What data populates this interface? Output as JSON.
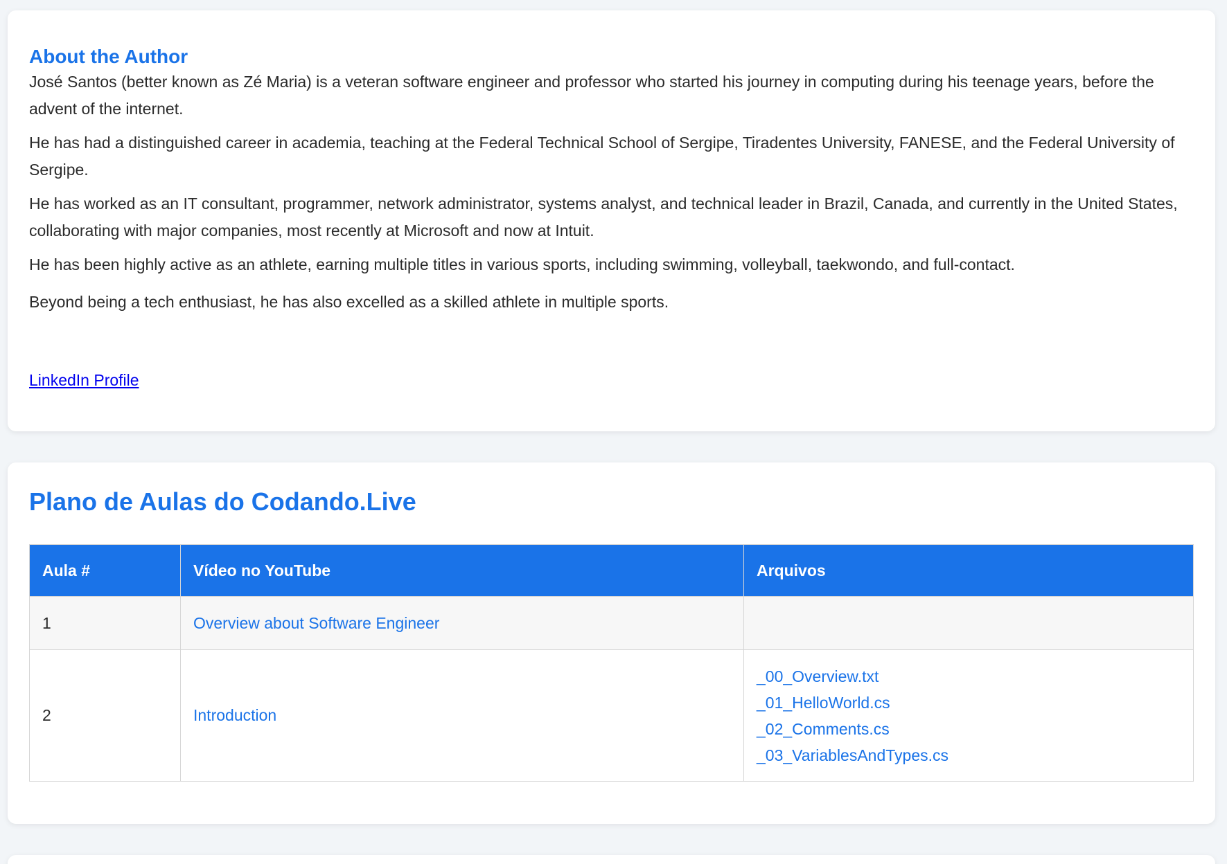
{
  "author": {
    "title": "About the Author",
    "paragraphs": [
      "José Santos (better known as Zé Maria) is a veteran software engineer and professor who started his journey in computing during his teenage years, before the advent of the internet.",
      "He has had a distinguished career in academia, teaching at the Federal Technical School of Sergipe, Tiradentes University, FANESE, and the Federal University of Sergipe.",
      "He has worked as an IT consultant, programmer, network administrator, systems analyst, and technical leader in Brazil, Canada, and currently in the United States, collaborating with major companies, most recently at Microsoft and now at Intuit.",
      "He has been highly active as an athlete, earning multiple titles in various sports, including swimming, volleyball, taekwondo, and full-contact.",
      "Beyond being a tech enthusiast, he has also excelled as a skilled athlete in multiple sports."
    ],
    "linkedin_label": "LinkedIn Profile"
  },
  "plan": {
    "title": "Plano de Aulas do Codando.Live",
    "headers": {
      "lesson": "Aula #",
      "video": "Vídeo no YouTube",
      "files": "Arquivos"
    },
    "rows": [
      {
        "number": "1",
        "video": "Overview about Software Engineer",
        "files": []
      },
      {
        "number": "2",
        "video": "Introduction",
        "files": [
          "_00_Overview.txt",
          "_01_HelloWorld.cs",
          "_02_Comments.cs",
          "_03_VariablesAndTypes.cs"
        ]
      }
    ]
  },
  "colors": {
    "accent": "#1a73e8",
    "visited_link": "#0000ee",
    "background": "#f2f5f8",
    "card": "#ffffff"
  }
}
